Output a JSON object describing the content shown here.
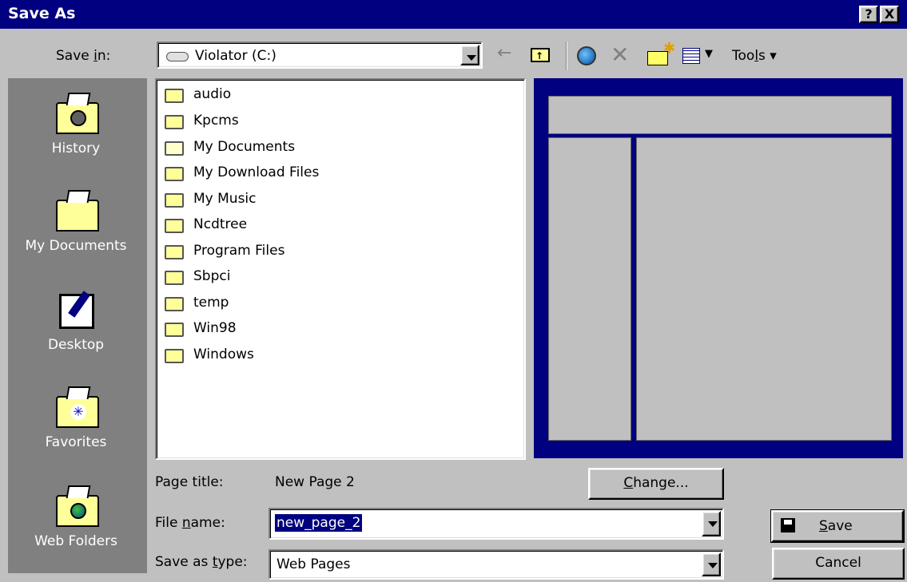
{
  "window": {
    "title": "Save As",
    "help_label": "?",
    "close_label": "X"
  },
  "savein": {
    "label": "Save in:",
    "value": "Violator (C:)"
  },
  "toolbar": {
    "tools_label": "Tools"
  },
  "places": [
    {
      "label": "History"
    },
    {
      "label": "My Documents"
    },
    {
      "label": "Desktop"
    },
    {
      "label": "Favorites"
    },
    {
      "label": "Web Folders"
    }
  ],
  "files": [
    {
      "name": "audio"
    },
    {
      "name": "Kpcms"
    },
    {
      "name": "My Documents"
    },
    {
      "name": "My Download Files"
    },
    {
      "name": "My Music"
    },
    {
      "name": "Ncdtree"
    },
    {
      "name": "Program Files"
    },
    {
      "name": "Sbpci"
    },
    {
      "name": "temp"
    },
    {
      "name": "Win98"
    },
    {
      "name": "Windows"
    }
  ],
  "form": {
    "page_title_label": "Page title:",
    "page_title_value": "New Page 2",
    "change_label": "Change...",
    "file_name_label": "File name:",
    "file_name_value": "new_page_2",
    "save_type_label": "Save as type:",
    "save_type_value": "Web Pages",
    "save_label": "Save",
    "cancel_label": "Cancel"
  },
  "colors": {
    "title_bar": "#000080",
    "face": "#c0c0c0",
    "places_bar": "#808080",
    "selection": "#000080"
  },
  "icons": [
    "drive-icon",
    "back-arrow-icon",
    "up-folder-icon",
    "search-web-icon",
    "delete-icon",
    "new-folder-icon",
    "views-icon",
    "floppy-disk-icon",
    "folder-icon"
  ]
}
